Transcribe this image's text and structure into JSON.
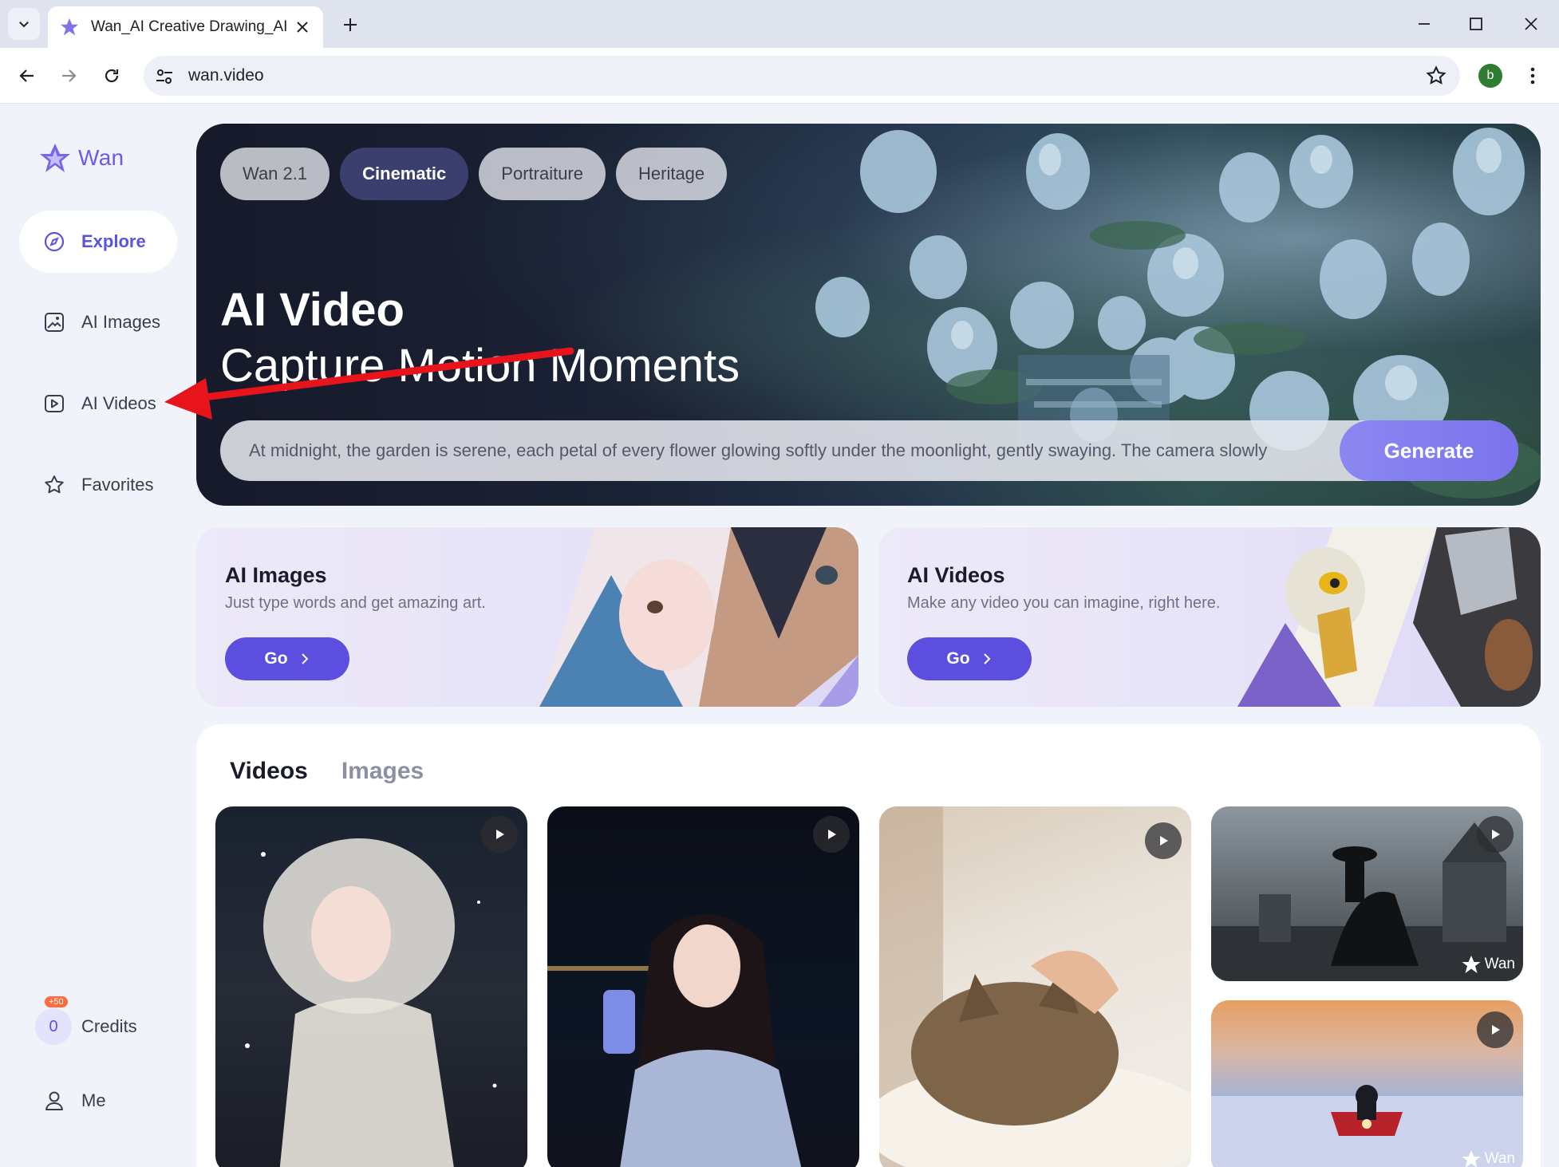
{
  "browser": {
    "tab_title": "Wan_AI Creative Drawing_AI Painting_Artificial Intelligence_Large Model",
    "url": "wan.video",
    "profile_initial": "b"
  },
  "sidebar": {
    "brand": "Wan",
    "items": [
      {
        "label": "Explore",
        "icon": "compass-icon",
        "active": true
      },
      {
        "label": "AI Images",
        "icon": "image-icon"
      },
      {
        "label": "AI Videos",
        "icon": "video-icon"
      },
      {
        "label": "Favorites",
        "icon": "star-icon"
      }
    ],
    "credits_badge": "+50",
    "credits_value": "0",
    "credits_label": "Credits",
    "me_label": "Me"
  },
  "hero": {
    "style_tabs": [
      "Wan 2.1",
      "Cinematic",
      "Portraiture",
      "Heritage"
    ],
    "active_tab": "Cinematic",
    "title": "AI Video",
    "subtitle": "Capture Motion Moments",
    "prompt": "At midnight, the garden is serene, each petal of every flower glowing softly under the moonlight, gently swaying. The camera slowly",
    "generate_label": "Generate"
  },
  "cards": [
    {
      "title": "AI Images",
      "desc": "Just type words and get amazing art.",
      "go": "Go"
    },
    {
      "title": "AI Videos",
      "desc": "Make any video you can imagine, right here.",
      "go": "Go"
    }
  ],
  "gallery": {
    "tabs": [
      "Videos",
      "Images"
    ],
    "active_tab": "Videos",
    "watermark": "Wan"
  },
  "colors": {
    "accent": "#5c4fe0",
    "active_style_tab": "#3b3f6e",
    "annotation_arrow": "#e8141b"
  }
}
